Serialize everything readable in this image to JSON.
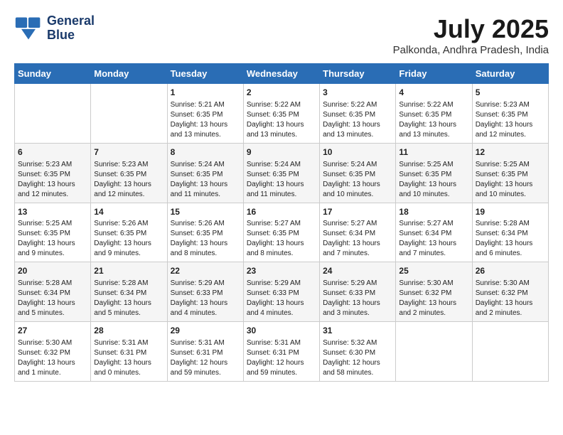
{
  "logo": {
    "line1": "General",
    "line2": "Blue"
  },
  "title": "July 2025",
  "location": "Palkonda, Andhra Pradesh, India",
  "days_of_week": [
    "Sunday",
    "Monday",
    "Tuesday",
    "Wednesday",
    "Thursday",
    "Friday",
    "Saturday"
  ],
  "weeks": [
    [
      {
        "day": "",
        "info": ""
      },
      {
        "day": "",
        "info": ""
      },
      {
        "day": "1",
        "info": "Sunrise: 5:21 AM\nSunset: 6:35 PM\nDaylight: 13 hours\nand 13 minutes."
      },
      {
        "day": "2",
        "info": "Sunrise: 5:22 AM\nSunset: 6:35 PM\nDaylight: 13 hours\nand 13 minutes."
      },
      {
        "day": "3",
        "info": "Sunrise: 5:22 AM\nSunset: 6:35 PM\nDaylight: 13 hours\nand 13 minutes."
      },
      {
        "day": "4",
        "info": "Sunrise: 5:22 AM\nSunset: 6:35 PM\nDaylight: 13 hours\nand 13 minutes."
      },
      {
        "day": "5",
        "info": "Sunrise: 5:23 AM\nSunset: 6:35 PM\nDaylight: 13 hours\nand 12 minutes."
      }
    ],
    [
      {
        "day": "6",
        "info": "Sunrise: 5:23 AM\nSunset: 6:35 PM\nDaylight: 13 hours\nand 12 minutes."
      },
      {
        "day": "7",
        "info": "Sunrise: 5:23 AM\nSunset: 6:35 PM\nDaylight: 13 hours\nand 12 minutes."
      },
      {
        "day": "8",
        "info": "Sunrise: 5:24 AM\nSunset: 6:35 PM\nDaylight: 13 hours\nand 11 minutes."
      },
      {
        "day": "9",
        "info": "Sunrise: 5:24 AM\nSunset: 6:35 PM\nDaylight: 13 hours\nand 11 minutes."
      },
      {
        "day": "10",
        "info": "Sunrise: 5:24 AM\nSunset: 6:35 PM\nDaylight: 13 hours\nand 10 minutes."
      },
      {
        "day": "11",
        "info": "Sunrise: 5:25 AM\nSunset: 6:35 PM\nDaylight: 13 hours\nand 10 minutes."
      },
      {
        "day": "12",
        "info": "Sunrise: 5:25 AM\nSunset: 6:35 PM\nDaylight: 13 hours\nand 10 minutes."
      }
    ],
    [
      {
        "day": "13",
        "info": "Sunrise: 5:25 AM\nSunset: 6:35 PM\nDaylight: 13 hours\nand 9 minutes."
      },
      {
        "day": "14",
        "info": "Sunrise: 5:26 AM\nSunset: 6:35 PM\nDaylight: 13 hours\nand 9 minutes."
      },
      {
        "day": "15",
        "info": "Sunrise: 5:26 AM\nSunset: 6:35 PM\nDaylight: 13 hours\nand 8 minutes."
      },
      {
        "day": "16",
        "info": "Sunrise: 5:27 AM\nSunset: 6:35 PM\nDaylight: 13 hours\nand 8 minutes."
      },
      {
        "day": "17",
        "info": "Sunrise: 5:27 AM\nSunset: 6:34 PM\nDaylight: 13 hours\nand 7 minutes."
      },
      {
        "day": "18",
        "info": "Sunrise: 5:27 AM\nSunset: 6:34 PM\nDaylight: 13 hours\nand 7 minutes."
      },
      {
        "day": "19",
        "info": "Sunrise: 5:28 AM\nSunset: 6:34 PM\nDaylight: 13 hours\nand 6 minutes."
      }
    ],
    [
      {
        "day": "20",
        "info": "Sunrise: 5:28 AM\nSunset: 6:34 PM\nDaylight: 13 hours\nand 5 minutes."
      },
      {
        "day": "21",
        "info": "Sunrise: 5:28 AM\nSunset: 6:34 PM\nDaylight: 13 hours\nand 5 minutes."
      },
      {
        "day": "22",
        "info": "Sunrise: 5:29 AM\nSunset: 6:33 PM\nDaylight: 13 hours\nand 4 minutes."
      },
      {
        "day": "23",
        "info": "Sunrise: 5:29 AM\nSunset: 6:33 PM\nDaylight: 13 hours\nand 4 minutes."
      },
      {
        "day": "24",
        "info": "Sunrise: 5:29 AM\nSunset: 6:33 PM\nDaylight: 13 hours\nand 3 minutes."
      },
      {
        "day": "25",
        "info": "Sunrise: 5:30 AM\nSunset: 6:32 PM\nDaylight: 13 hours\nand 2 minutes."
      },
      {
        "day": "26",
        "info": "Sunrise: 5:30 AM\nSunset: 6:32 PM\nDaylight: 13 hours\nand 2 minutes."
      }
    ],
    [
      {
        "day": "27",
        "info": "Sunrise: 5:30 AM\nSunset: 6:32 PM\nDaylight: 13 hours\nand 1 minute."
      },
      {
        "day": "28",
        "info": "Sunrise: 5:31 AM\nSunset: 6:31 PM\nDaylight: 13 hours\nand 0 minutes."
      },
      {
        "day": "29",
        "info": "Sunrise: 5:31 AM\nSunset: 6:31 PM\nDaylight: 12 hours\nand 59 minutes."
      },
      {
        "day": "30",
        "info": "Sunrise: 5:31 AM\nSunset: 6:31 PM\nDaylight: 12 hours\nand 59 minutes."
      },
      {
        "day": "31",
        "info": "Sunrise: 5:32 AM\nSunset: 6:30 PM\nDaylight: 12 hours\nand 58 minutes."
      },
      {
        "day": "",
        "info": ""
      },
      {
        "day": "",
        "info": ""
      }
    ]
  ]
}
